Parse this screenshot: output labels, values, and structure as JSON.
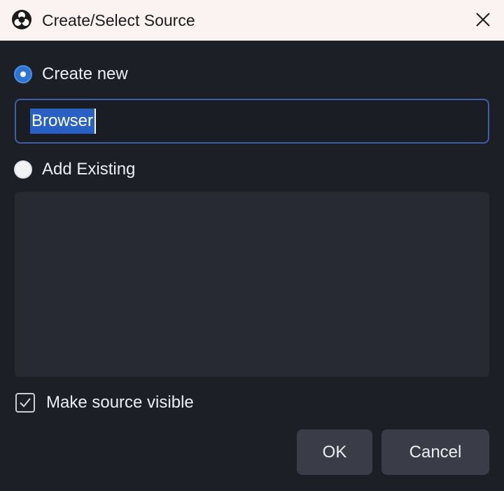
{
  "window": {
    "title": "Create/Select Source",
    "app_icon": "obs-logo-icon",
    "close_icon": "close-icon"
  },
  "options": {
    "create_new": {
      "label": "Create new",
      "checked": true
    },
    "add_existing": {
      "label": "Add Existing",
      "checked": false
    }
  },
  "name_input": {
    "value": "Browser"
  },
  "existing_sources": [],
  "make_visible": {
    "label": "Make source visible",
    "checked": true
  },
  "buttons": {
    "ok": "OK",
    "cancel": "Cancel"
  },
  "colors": {
    "accent": "#2f74d0",
    "background": "#1d1f26",
    "titlebar": "#faf3f2",
    "button": "#3a3d47",
    "selection": "#2860c4"
  }
}
